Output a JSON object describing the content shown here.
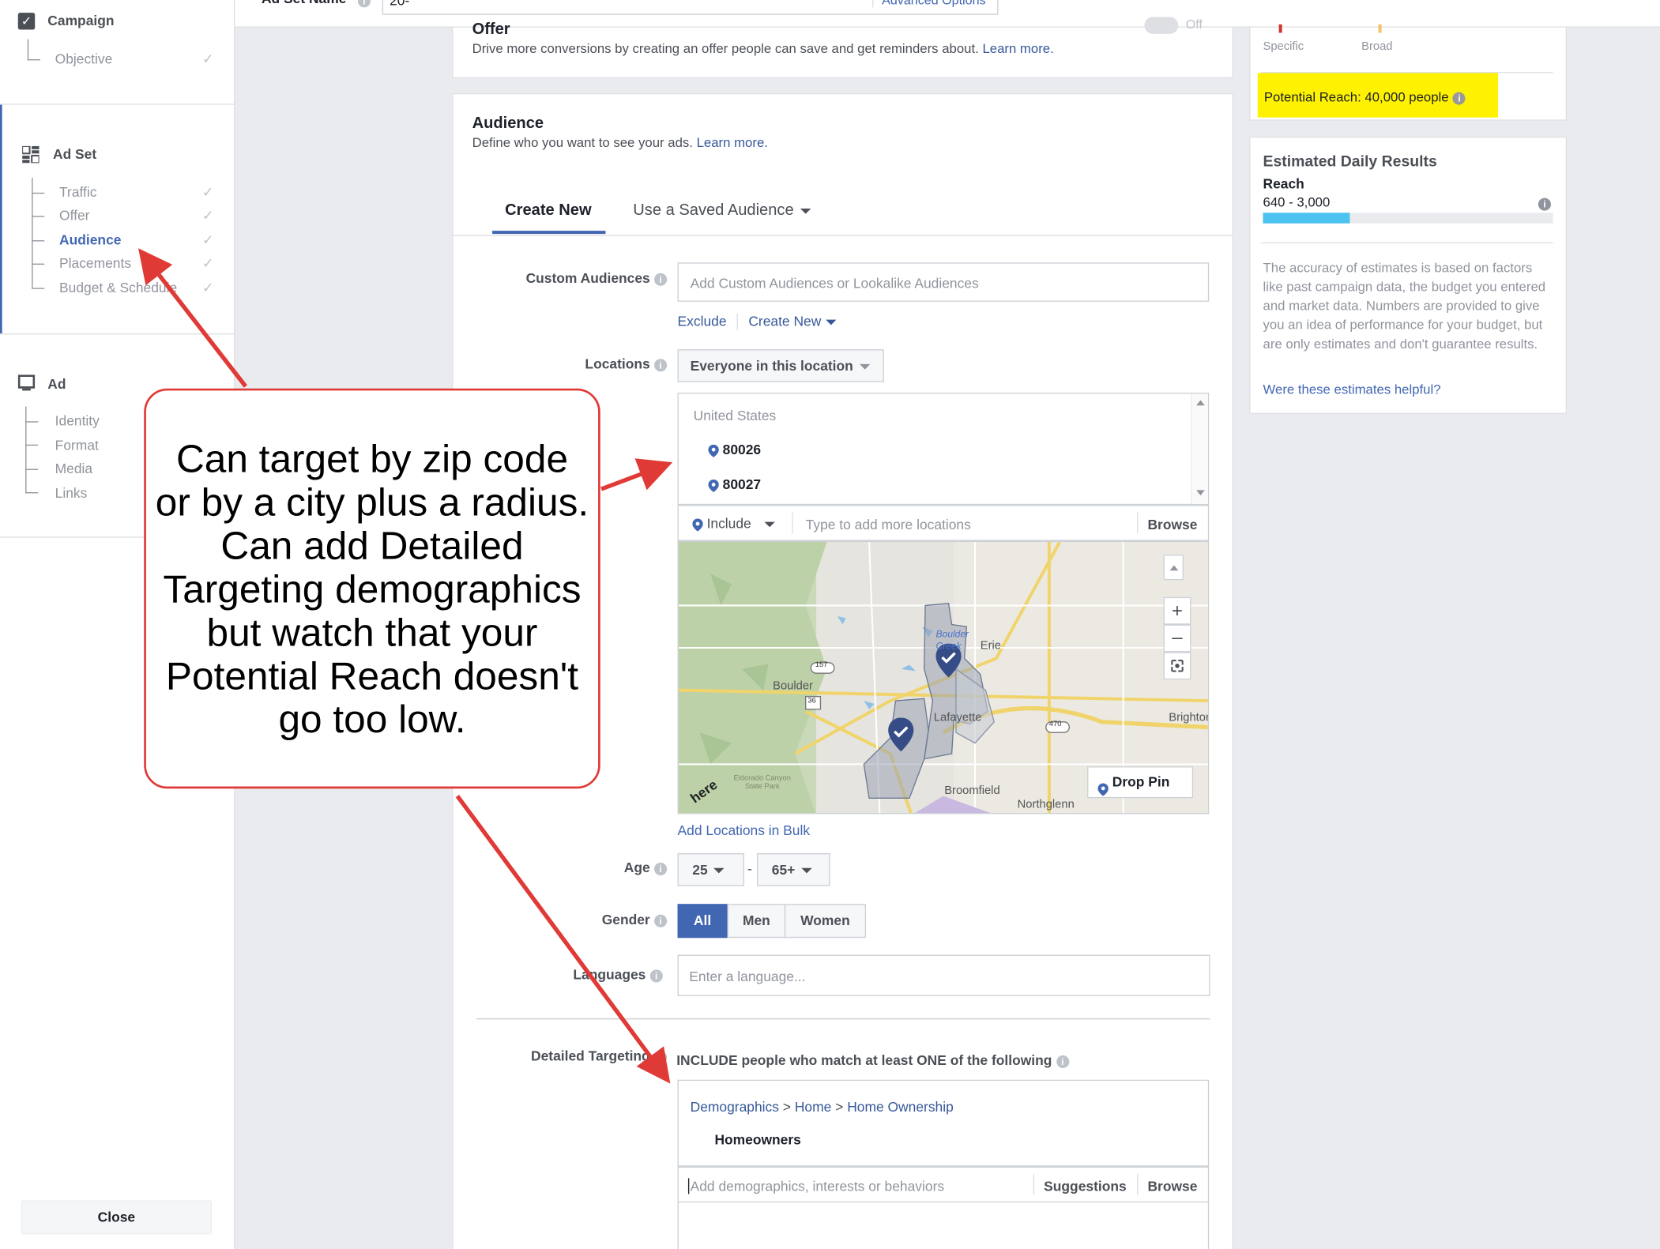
{
  "left_nav": {
    "campaign": {
      "title": "Campaign",
      "items": [
        "Objective"
      ]
    },
    "ad_set": {
      "title": "Ad Set",
      "items": [
        "Traffic",
        "Offer",
        "Audience",
        "Placements",
        "Budget & Schedule"
      ],
      "active": "Audience"
    },
    "ad": {
      "title": "Ad",
      "items": [
        "Identity",
        "Format",
        "Media",
        "Links"
      ]
    },
    "close_label": "Close"
  },
  "topbar": {
    "adset_name_label": "Ad Set Name",
    "adset_name_value": "20-",
    "advanced_options": "Advanced Options",
    "toggle_text": "Off"
  },
  "offer": {
    "title": "Offer",
    "description": "Drive more conversions by creating an offer people can save and get reminders about.",
    "learn_more": "Learn more."
  },
  "audience": {
    "title": "Audience",
    "description": "Define who you want to see your ads.",
    "learn_more": "Learn more.",
    "tabs": [
      "Create New",
      "Use a Saved Audience"
    ],
    "active_tab": "Create New",
    "custom_audiences": {
      "label": "Custom Audiences",
      "placeholder": "Add Custom Audiences or Lookalike Audiences",
      "exclude": "Exclude",
      "create_new": "Create New"
    },
    "locations": {
      "label": "Locations",
      "dropdown": "Everyone in this location",
      "country": "United States",
      "entries": [
        "80026",
        "80027"
      ],
      "include": "Include",
      "placeholder": "Type to add more locations",
      "browse": "Browse",
      "add_bulk": "Add Locations in Bulk"
    },
    "map": {
      "places": [
        "Boulder",
        "Boulder Creek",
        "Erie",
        "Lafayette",
        "Brighton",
        "Broomfield",
        "Northglenn",
        "Eldorado Canyon State Park"
      ],
      "road_labels": [
        "157",
        "36",
        "470"
      ],
      "drop_pin": "Drop Pin",
      "brand": "here"
    },
    "age": {
      "label": "Age",
      "min": "25",
      "max": "65+",
      "separator": "-"
    },
    "gender": {
      "label": "Gender",
      "options": [
        "All",
        "Men",
        "Women"
      ],
      "selected": "All"
    },
    "languages": {
      "label": "Languages",
      "placeholder": "Enter a language..."
    },
    "detailed": {
      "label": "Detailed Targeting",
      "include_text": "INCLUDE people who match at least ONE of the following",
      "breadcrumb": [
        "Demographics",
        "Home",
        "Home Ownership"
      ],
      "breadcrumb_sep": ">",
      "item": "Homeowners",
      "placeholder": "Add demographics, interests or behaviors",
      "suggestions": "Suggestions",
      "browse": "Browse"
    }
  },
  "reach": {
    "specific": "Specific",
    "broad": "Broad",
    "potential": "Potential Reach: 40,000 people"
  },
  "estimates": {
    "title": "Estimated Daily Results",
    "reach_label": "Reach",
    "reach_range": "640 - 3,000",
    "bar_fraction": 0.3,
    "note": "The accuracy of estimates is based on factors like past campaign data, the budget you entered and market data. Numbers are provided to give you an idea of performance for your budget, but are only estimates and don't guarantee results.",
    "helpful": "Were these estimates helpful?"
  },
  "callout": {
    "text": "Can target by zip code or by a city plus a radius. Can add Detailed Targeting demographics but watch that your Potential Reach doesn't go too low."
  },
  "colors": {
    "brand_blue": "#4267b2",
    "link": "#365899",
    "highlight": "#fff200",
    "arrow": "#e03a36",
    "bar": "#4cc2f1"
  }
}
